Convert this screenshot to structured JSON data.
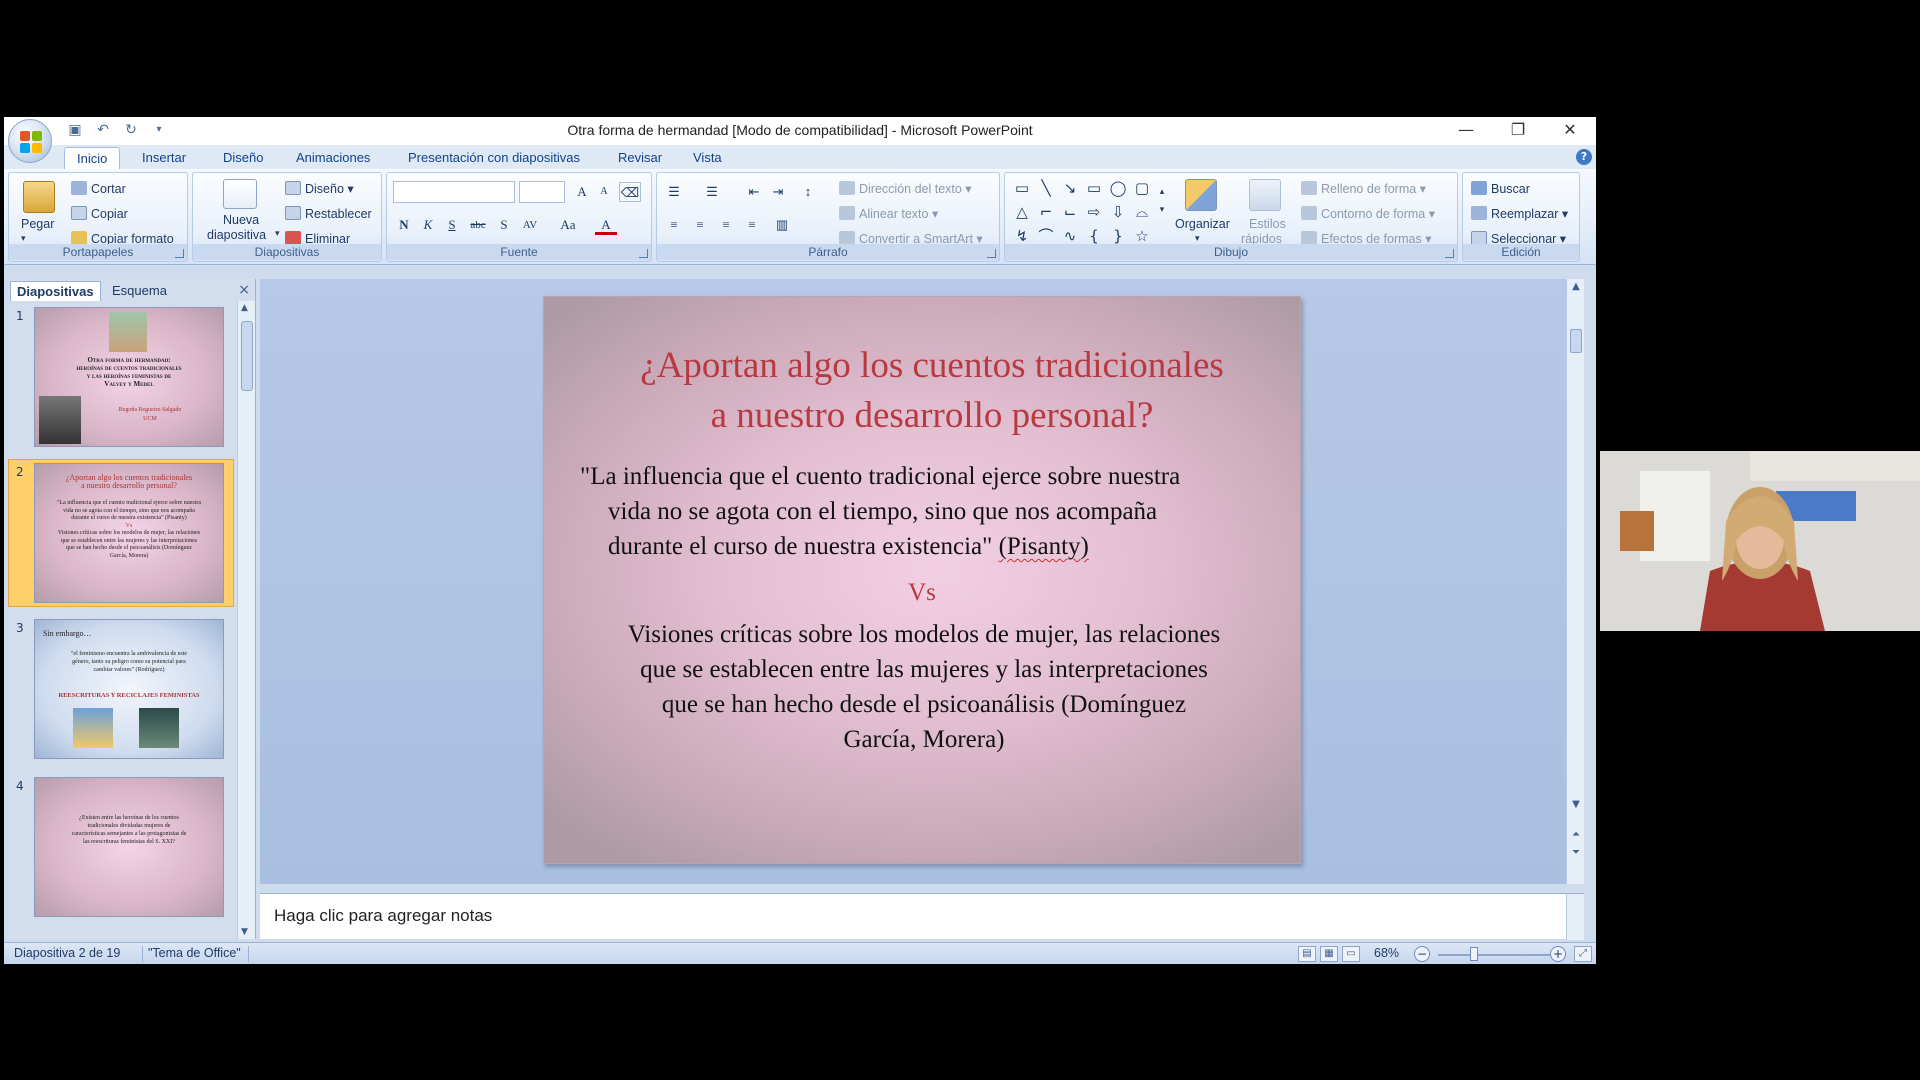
{
  "window": {
    "title": "Otra forma de hermandad [Modo de compatibilidad] - Microsoft PowerPoint",
    "minimize": "—",
    "maximize": "❐",
    "close": "✕"
  },
  "tabs": [
    "Inicio",
    "Insertar",
    "Diseño",
    "Animaciones",
    "Presentación con diapositivas",
    "Revisar",
    "Vista"
  ],
  "ribbon": {
    "portapapeles": {
      "label": "Portapapeles",
      "paste": "Pegar",
      "cut": "Cortar",
      "copy": "Copiar",
      "format": "Copiar formato"
    },
    "diapositivas": {
      "label": "Diapositivas",
      "new1": "Nueva",
      "new2": "diapositiva",
      "design": "Diseño",
      "reset": "Restablecer",
      "delete": "Eliminar"
    },
    "fuente": {
      "label": "Fuente",
      "bold": "N",
      "italic": "K",
      "underline": "S",
      "strike": "abc",
      "shadow": "S",
      "spacing": "AV",
      "case": "Aa",
      "color": "A",
      "grow": "A",
      "shrink": "A"
    },
    "parrafo": {
      "label": "Párrafo",
      "direction": "Dirección del texto",
      "align": "Alinear texto",
      "smartart": "Convertir a SmartArt"
    },
    "dibujo": {
      "label": "Dibujo",
      "arrange": "Organizar",
      "styles1": "Estilos",
      "styles2": "rápidos",
      "fill": "Relleno de forma",
      "outline": "Contorno de forma",
      "effects": "Efectos de formas"
    },
    "edicion": {
      "label": "Edición",
      "find": "Buscar",
      "replace": "Reemplazar",
      "select": "Seleccionar"
    }
  },
  "panel": {
    "tab_slides": "Diapositivas",
    "tab_outline": "Esquema",
    "close": "×",
    "thumbnails": [
      {
        "num": "1",
        "lines": [
          "Otra forma de hermandad:",
          "heroínas de cuentos tradicionales",
          "y las heroínas feministas de",
          "Valvey y Medel"
        ],
        "sub": [
          "Begoña Regueiro Salgado",
          "UCM"
        ]
      },
      {
        "num": "2",
        "title": [
          "¿Aportan algo los cuentos tradicionales",
          "a nuestro desarrollo personal?"
        ],
        "lines": [
          "\"La influencia que el cuento tradicional ejerce sobre nuestra",
          "vida no se agota con el tiempo, sino que nos acompaña",
          "durante el curso de nuestra existencia\" (Pisanty)",
          "Vs",
          "Visiones críticas sobre los modelos de mujer, las relaciones",
          "que se establecen entre las mujeres y las interpretaciones",
          "que se han hecho desde el psicoanálisis (Domínguez",
          "García, Morera)"
        ]
      },
      {
        "num": "3",
        "heading": "Sin embargo…",
        "lines": [
          "\"el feminismo encuentra la ambivalencia de este",
          "género, tanto su peligro como su potencial para",
          "cambiar valores\" (Rodríguez)"
        ],
        "red": "REESCRITURAS Y RECICLAJES FEMINISTAS"
      },
      {
        "num": "4",
        "lines": [
          "¿Existen entre las heroínas de los cuentos",
          "tradicionales dividadas mujeres de",
          "características semejantes a las protagonistas de",
          "las reescrituras feministas del S. XXI?"
        ]
      }
    ]
  },
  "slide": {
    "title_line1": "¿Aportan algo los cuentos tradicionales",
    "title_line2": "a nuestro desarrollo personal?",
    "quote_line1": "\"La influencia que el cuento tradicional ejerce sobre nuestra",
    "quote_line2": "vida no se agota con el tiempo, sino que nos acompaña",
    "quote_line3": "durante el curso de nuestra existencia\" ",
    "quote_author": "(Pisanty)",
    "vs": "Vs",
    "critic_line1": "Visiones críticas sobre los modelos de mujer, las relaciones",
    "critic_line2": "que se establecen entre las mujeres y las interpretaciones",
    "critic_line3": "que se han hecho desde el psicoanálisis (Domínguez",
    "critic_line4": "García, Morera)"
  },
  "notes": {
    "placeholder": "Haga clic para agregar notas"
  },
  "status": {
    "slide_info": "Diapositiva 2 de 19",
    "theme": "\"Tema de Office\"",
    "zoom": "68%",
    "zoom_fraction": 0.68
  },
  "colors": {
    "accent": "#15428b",
    "title_red": "#b8393f",
    "selected": "#ffcf6a"
  }
}
